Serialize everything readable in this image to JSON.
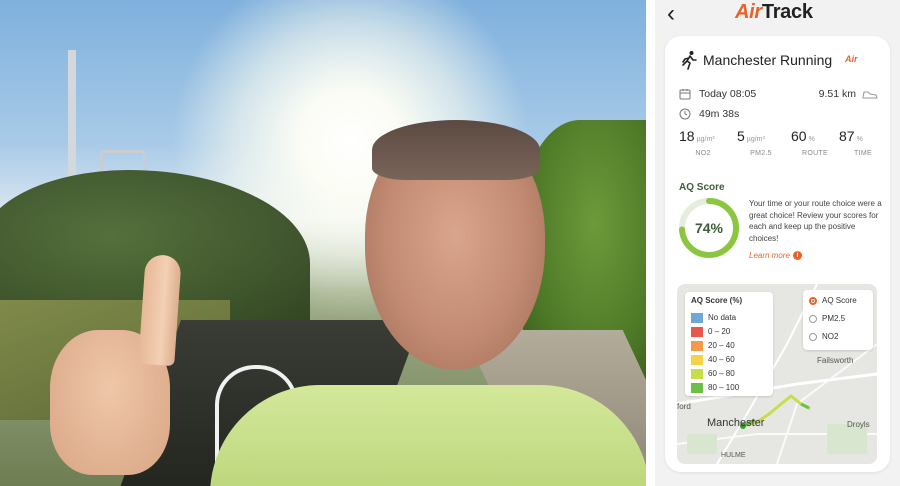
{
  "app": {
    "brand_accent": "Air",
    "brand_rest": "Track",
    "back_icon": "chevron-left-icon",
    "accent_color": "#e8632c"
  },
  "run": {
    "title": "Manchester Running",
    "badge": "Air",
    "date_time": "Today 08:05",
    "distance": "9.51 km",
    "duration": "49m 38s"
  },
  "stats": [
    {
      "value": "18",
      "unit": "µg/m³",
      "label": "NO2"
    },
    {
      "value": "5",
      "unit": "µg/m³",
      "label": "PM2.5"
    },
    {
      "value": "60",
      "unit": "%",
      "label": "ROUTE"
    },
    {
      "value": "87",
      "unit": "%",
      "label": "TIME"
    }
  ],
  "aq": {
    "title": "AQ Score",
    "score_text": "74%",
    "score_fraction": 0.74,
    "ring_color": "#8cc63f",
    "description": "Your time or your route choice were a great choice! Review your scores for each and keep up the positive choices!",
    "learn_more": "Learn more",
    "info_glyph": "i"
  },
  "map": {
    "legend_title": "AQ Score (%)",
    "legend": [
      {
        "label": "No data",
        "color": "#6fa8d6"
      },
      {
        "label": "0 – 20",
        "color": "#e8574a"
      },
      {
        "label": "20 – 40",
        "color": "#f2994a"
      },
      {
        "label": "40 – 60",
        "color": "#f6d24a"
      },
      {
        "label": "60 – 80",
        "color": "#c9dc4a"
      },
      {
        "label": "80 – 100",
        "color": "#6cc04a"
      }
    ],
    "layers": [
      {
        "label": "AQ Score",
        "selected": true
      },
      {
        "label": "PM2.5",
        "selected": false
      },
      {
        "label": "NO2",
        "selected": false
      }
    ],
    "places": {
      "failsworth": "Failsworth",
      "ford": "ford",
      "manchester": "Manchester",
      "droylsden": "Droyls",
      "hulme": "HULME"
    }
  }
}
